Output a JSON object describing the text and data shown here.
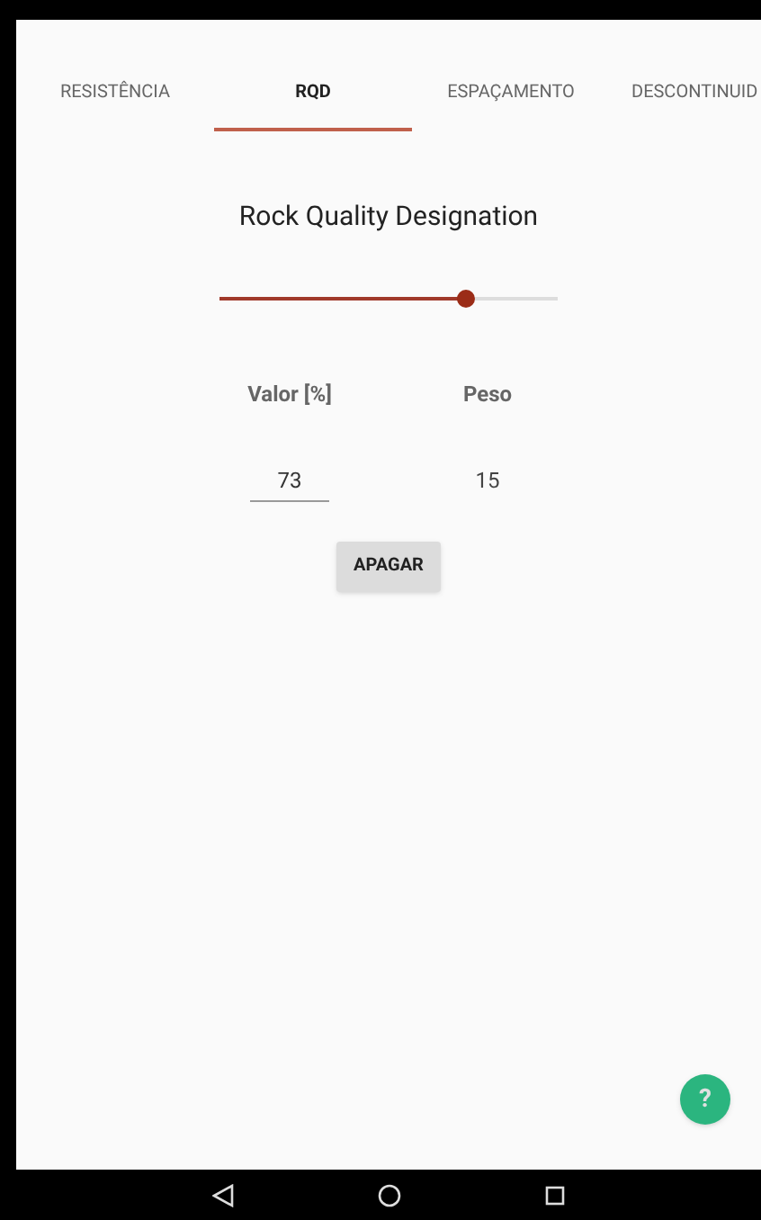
{
  "tabs": [
    {
      "label": "RESISTÊNCIA",
      "selected": false
    },
    {
      "label": "RQD",
      "selected": true
    },
    {
      "label": "ESPAÇAMENTO",
      "selected": false
    },
    {
      "label": "DESCONTINUID",
      "selected": false
    }
  ],
  "title": "Rock Quality Designation",
  "slider": {
    "level": 0.73
  },
  "value_label": "Valor [%]",
  "weight_label": "Peso",
  "value_field": "73",
  "weight": "15",
  "clear_button": "APAGAR",
  "help_button": "?"
}
